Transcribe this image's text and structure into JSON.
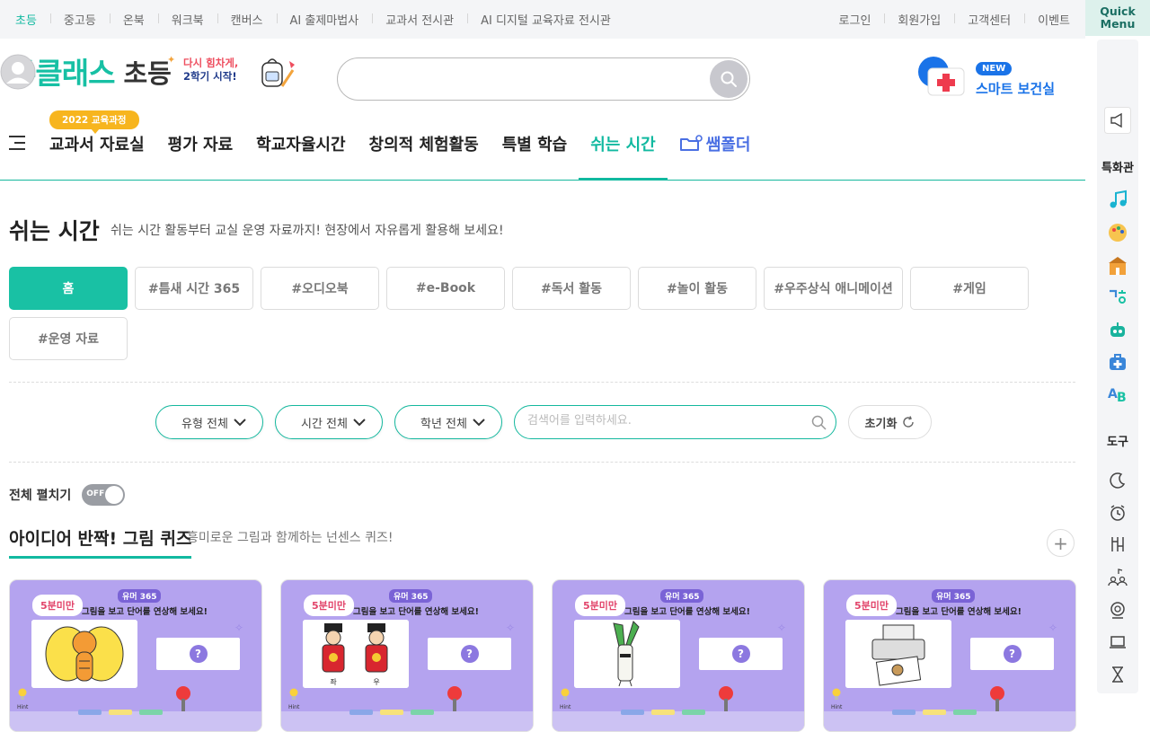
{
  "topbar": {
    "left": [
      "초등",
      "중고등",
      "온북",
      "워크북",
      "캔버스",
      "AI 출제마법사",
      "교과서 전시관",
      "AI 디지털 교육자료 전시관"
    ],
    "right": [
      "로그인",
      "회원가입",
      "고객센터",
      "이벤트"
    ]
  },
  "header": {
    "brand": "두클래스",
    "brand_sub": "초등",
    "promo_line1": "다시 힘차게,",
    "promo_line2": "2학기 시작!",
    "search_placeholder": "",
    "clinic_new": "NEW",
    "clinic_label": "스마트 보건실"
  },
  "nav": {
    "badge": "2022 교육과정",
    "items": [
      "교과서 자료실",
      "평가 자료",
      "학교자율시간",
      "창의적 체험활동",
      "특별 학습",
      "쉬는 시간",
      "쌤폴더"
    ],
    "active": "쉬는 시간"
  },
  "page": {
    "title": "쉬는 시간",
    "description": "쉬는 시간 활동부터 교실 운영 자료까지! 현장에서 자유롭게 활용해 보세요!"
  },
  "chips": [
    "홈",
    "#틈새 시간 365",
    "#오디오북",
    "#e-Book",
    "#독서 활동",
    "#놀이 활동",
    "#우주상식 애니메이션",
    "#게임",
    "#운영 자료"
  ],
  "filters": {
    "type": "유형 전체",
    "time": "시간 전체",
    "grade": "학년 전체",
    "search_placeholder": "검색어를 입력하세요.",
    "reset": "초기화"
  },
  "expand": {
    "label": "전체 펼치기",
    "state": "OFF"
  },
  "section": {
    "title": "아이디어 반짝! 그림 퀴즈",
    "description": "흥미로운 그림과 함께하는 넌센스 퀴즈!"
  },
  "cards": [
    {
      "time": "5분미만",
      "brand": "유머 365",
      "instruction": "그림을 보고 단어를 연상해 보세요!",
      "answer": "?",
      "hint": "Hint",
      "image": "tiger-butterfly"
    },
    {
      "time": "5분미만",
      "brand": "유머 365",
      "instruction": "그림을 보고 단어를 연상해 보세요!",
      "answer": "?",
      "hint": "Hint",
      "image": "two-kings",
      "image_caption_left": "좌",
      "image_caption_right": "우"
    },
    {
      "time": "5분미만",
      "brand": "유머 365",
      "instruction": "그림을 보고 단어를 연상해 보세요!",
      "answer": "?",
      "hint": "Hint",
      "image": "green-onion"
    },
    {
      "time": "5분미만",
      "brand": "유머 365",
      "instruction": "그림을 보고 단어를 연상해 보세요!",
      "answer": "?",
      "hint": "Hint",
      "image": "printer-cow"
    }
  ],
  "quick_menu": {
    "title_line1": "Quick",
    "title_line2": "Menu",
    "special_label": "특화관",
    "special_icons": [
      "music-note-icon",
      "palette-icon",
      "school-icon",
      "hangul-icon",
      "robot-icon",
      "first-aid-icon",
      "english-ab-icon"
    ],
    "tools_label": "도구",
    "tool_icons": [
      "moon-icon",
      "alarm-clock-icon",
      "ladder-icon",
      "people-music-icon",
      "roulette-icon",
      "laptop-icon",
      "hourglass-icon"
    ]
  },
  "colors": {
    "accent": "#11b9a0",
    "card_bg": "#b4a3ef",
    "brand_blue": "#1a73e8"
  }
}
